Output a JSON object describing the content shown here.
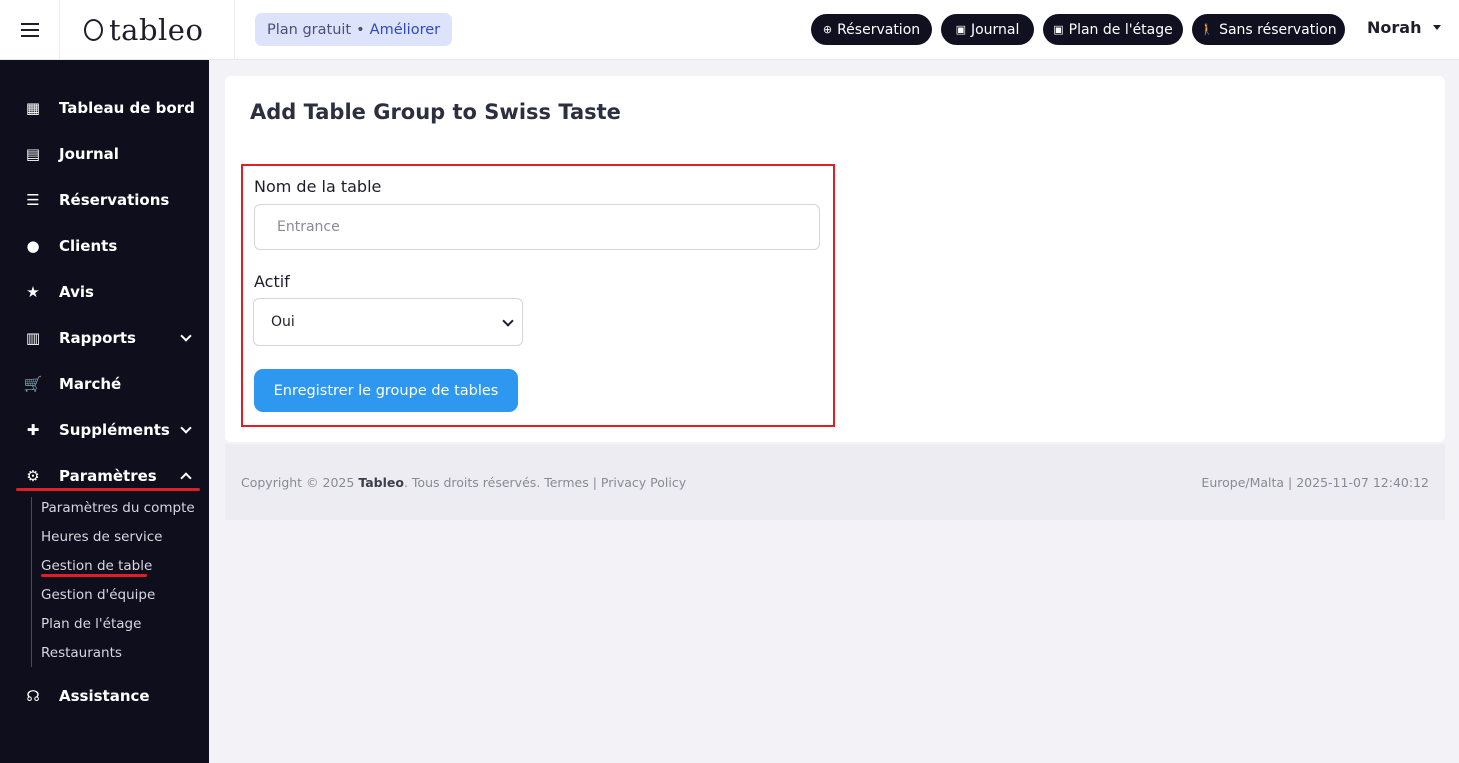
{
  "brand": {
    "logo_text": "tableo"
  },
  "plan": {
    "label": "Plan gratuit",
    "separator": "•",
    "upgrade": "Améliorer"
  },
  "top_actions": [
    {
      "icon": "plus-circle-icon",
      "label": "Réservation"
    },
    {
      "icon": "calendar-icon",
      "label": "Journal"
    },
    {
      "icon": "calendar-icon",
      "label": "Plan de l'étage"
    },
    {
      "icon": "walking-person-icon",
      "label": "Sans réservation"
    }
  ],
  "user": {
    "name": "Norah"
  },
  "sidebar": {
    "items": [
      {
        "label": "Tableau de bord",
        "icon": "dashboard-icon"
      },
      {
        "label": "Journal",
        "icon": "book-icon"
      },
      {
        "label": "Réservations",
        "icon": "list-icon"
      },
      {
        "label": "Clients",
        "icon": "user-icon"
      },
      {
        "label": "Avis",
        "icon": "star-icon"
      },
      {
        "label": "Rapports",
        "icon": "chart-icon"
      },
      {
        "label": "Marché",
        "icon": "cart-icon"
      },
      {
        "label": "Suppléments",
        "icon": "puzzle-icon"
      },
      {
        "label": "Paramètres",
        "icon": "gear-icon"
      },
      {
        "label": "Assistance",
        "icon": "headset-icon"
      }
    ],
    "sub_items": [
      "Paramètres du compte",
      "Heures de service",
      "Gestion de table",
      "Gestion d'équipe",
      "Plan de l'étage",
      "Restaurants"
    ]
  },
  "page": {
    "title": "Add Table Group to Swiss Taste",
    "form": {
      "name_label": "Nom de la table",
      "name_placeholder": "Entrance",
      "active_label": "Actif",
      "active_value": "Oui",
      "submit_label": "Enregistrer le groupe de tables"
    }
  },
  "footer": {
    "copyright_prefix": "Copyright © 2025 ",
    "brand": "Tableo",
    "rights": ". Tous droits réservés. ",
    "terms": "Termes",
    "divider": " | ",
    "privacy": "Privacy Policy",
    "timezone_info": "Europe/Malta | 2025-11-07 12:40:12"
  },
  "colors": {
    "highlight": "#e21d24",
    "primary_button": "#2e97ef",
    "sidebar_bg": "#0e0e1c"
  }
}
